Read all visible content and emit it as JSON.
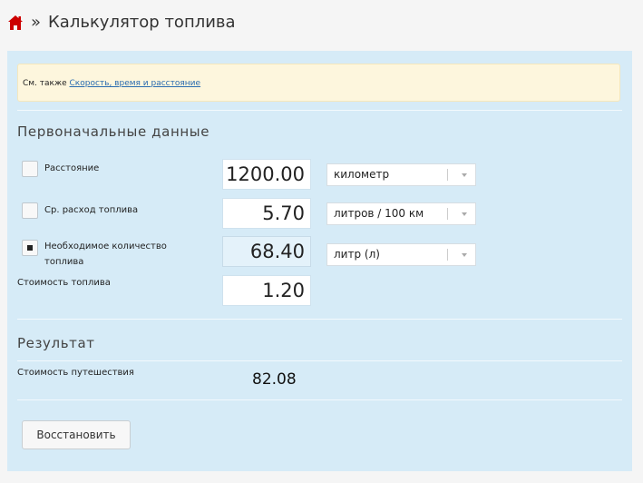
{
  "breadcrumb": {
    "home_icon": "home-icon",
    "home_color": "#cc0000",
    "separator": "»",
    "title": "Калькулятор топлива"
  },
  "notice": {
    "prefix": "См. также",
    "link_text": "Скорость, время и расстояние"
  },
  "inputs_section": {
    "title": "Первоначальные данные",
    "rows": [
      {
        "label": "Расстояние",
        "checked": false,
        "value": "1200.00",
        "unit": "километр"
      },
      {
        "label": "Ср. расход топлива",
        "checked": false,
        "value": "5.70",
        "unit": "литров / 100 км"
      },
      {
        "label_line1": "Необходимое количество",
        "label_line2": "топлива",
        "checked": true,
        "value": "68.40",
        "unit": "литр (л)"
      }
    ],
    "fuel_cost": {
      "label": "Стоимость топлива",
      "value": "1.20"
    }
  },
  "result_section": {
    "title": "Результат",
    "trip_cost_label": "Стоимость путешествия",
    "trip_cost_value": "82.08"
  },
  "reset_button": {
    "label": "Восстановить"
  },
  "colors": {
    "panel_bg": "#d6ebf7",
    "notice_bg": "#fdf6dd",
    "link": "#2a6cb0"
  }
}
